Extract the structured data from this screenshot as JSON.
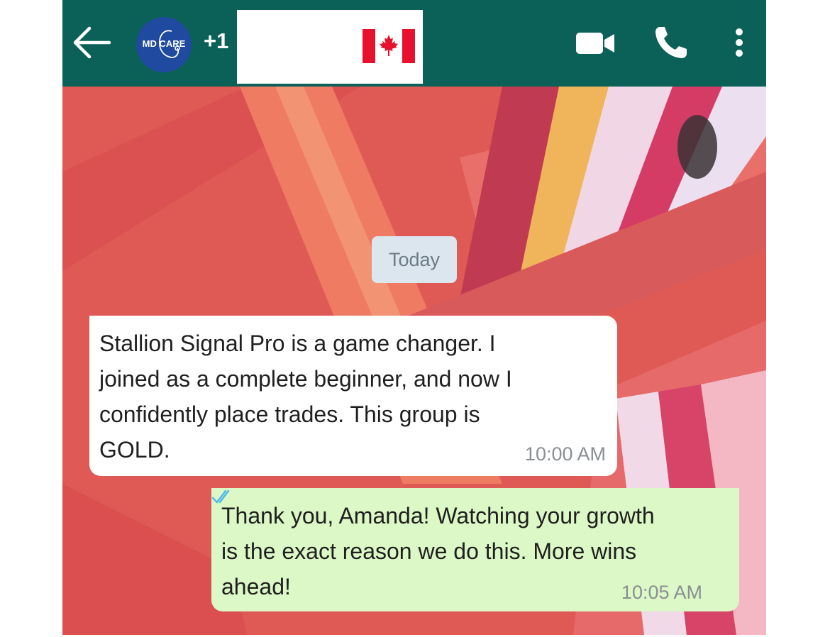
{
  "header": {
    "contact_prefix": "+1",
    "avatar_text": "MD CARE",
    "bg_color": "#0b6157"
  },
  "chat": {
    "date_label": "Today",
    "messages": [
      {
        "direction": "incoming",
        "text": "Stallion Signal Pro is a game changer. I\njoined as a complete beginner, and now I\nconfidently place trades. This group is\nGOLD.",
        "time": "10:00 AM"
      },
      {
        "direction": "outgoing",
        "text": "Thank you, Amanda! Watching your growth\nis the exact reason we do this. More wins\nahead!",
        "time": "10:05 AM",
        "status": "read"
      }
    ]
  },
  "icons": {
    "back": "arrow-left-icon",
    "video": "video-camera-icon",
    "call": "phone-icon",
    "menu": "more-vertical-icon",
    "read_receipt": "double-check-icon",
    "flag": "canada-flag-icon"
  },
  "colors": {
    "incoming_bubble": "#ffffff",
    "outgoing_bubble": "#dcf8c6",
    "read_ticks": "#4fb6ec",
    "date_chip": "#dbe6ef"
  }
}
